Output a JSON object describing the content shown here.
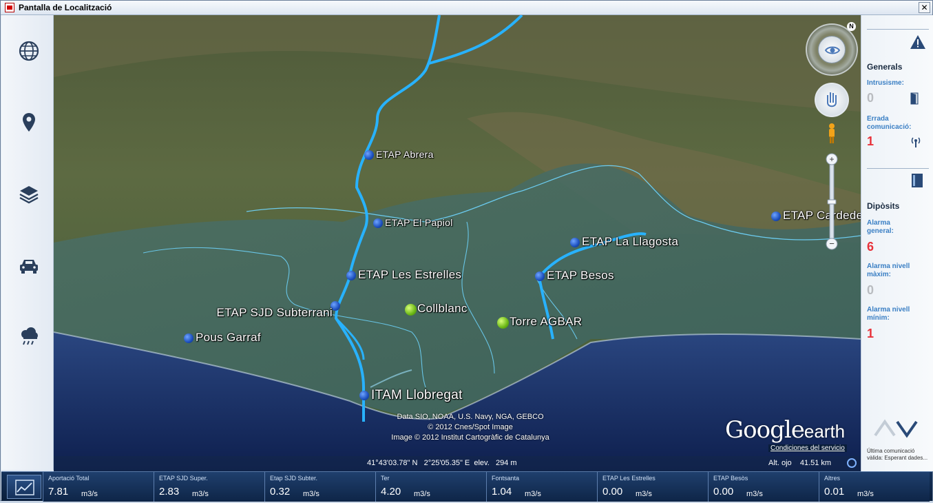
{
  "window": {
    "title": "Pantalla de Localització",
    "close_label": "✕"
  },
  "left_nav": [
    {
      "name": "globe-icon"
    },
    {
      "name": "map-pin-icon"
    },
    {
      "name": "layers-icon"
    },
    {
      "name": "car-icon"
    },
    {
      "name": "weather-icon"
    }
  ],
  "map": {
    "markers": {
      "etap_abrera": "ETAP Abrera",
      "etap_papiol": "ETAP El Papiol",
      "etap_estrelles": "ETAP Les Estrelles",
      "etap_sjd": "ETAP SJD Subterrani",
      "collblanc": "Collblanc",
      "pous_garraf": "Pous Garraf",
      "itam_llobregat": "ITAM Llobregat",
      "etap_besos": "ETAP Besos",
      "etap_llagosta": "ETAP La Llagosta",
      "torre_agbar": "Torre AGBAR",
      "etap_cardedeu": "ETAP Cardede"
    },
    "credits": [
      "Data SIO, NOAA, U.S. Navy, NGA, GEBCO",
      "© 2012 Cnes/Spot Image",
      "Image © 2012 Institut Cartogràfic de Catalunya"
    ],
    "brand_google": "Google",
    "brand_earth": "earth",
    "terms_link": "Condiciones del servicio",
    "coordinates": "41°43'03.78\" N   2°25'05.35\" E  elev.   294 m",
    "eye_altitude": "Alt. ojo    41.51 km",
    "compass_north": "N"
  },
  "alerts_panel": {
    "generals": {
      "title": "Generals",
      "intrusisme_label": "Intrusisme:",
      "intrusisme_value": "0",
      "errada_label": "Errada comunicació:",
      "errada_value": "1"
    },
    "diposits": {
      "title": "Dipòsits",
      "alarma_general_label": "Alarma general:",
      "alarma_general_value": "6",
      "alarma_max_label": "Alarma nivell màxim:",
      "alarma_max_value": "0",
      "alarma_min_label": "Alarma nivell mínim:",
      "alarma_min_value": "1"
    },
    "last_comm": "Última comunicació vàlida: Esperant dades..."
  },
  "flows": [
    {
      "name": "Aportació Total",
      "value": "7.81",
      "unit": "m3/s"
    },
    {
      "name": "ETAP SJD Super.",
      "value": "2.83",
      "unit": "m3/s"
    },
    {
      "name": "Etap SJD Subter.",
      "value": "0.32",
      "unit": "m3/s"
    },
    {
      "name": "Ter",
      "value": "4.20",
      "unit": "m3/s"
    },
    {
      "name": "Fontsanta",
      "value": "1.04",
      "unit": "m3/s"
    },
    {
      "name": "ETAP Les Estrelles",
      "value": "0.00",
      "unit": "m3/s"
    },
    {
      "name": "ETAP Besòs",
      "value": "0.00",
      "unit": "m3/s"
    },
    {
      "name": "Altres",
      "value": "0.01",
      "unit": "m3/s"
    }
  ],
  "colors": {
    "accent": "#3a7fc4",
    "alarm": "#e8323a",
    "pipeline": "#2fb4ff"
  }
}
